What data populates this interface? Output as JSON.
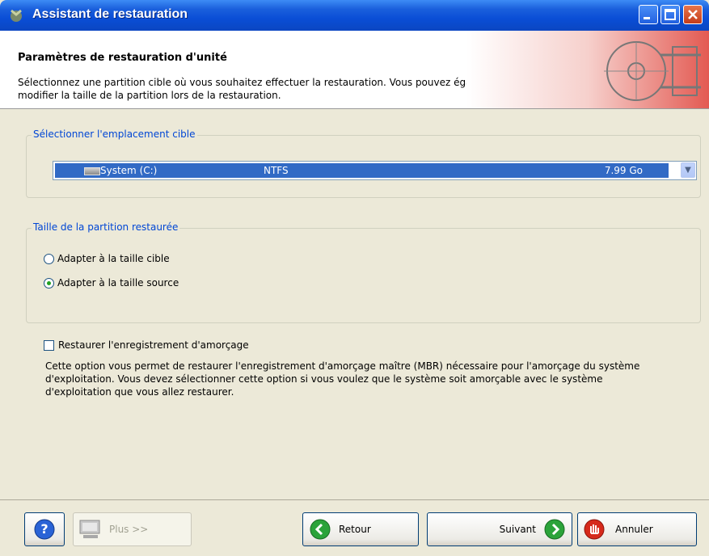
{
  "window": {
    "title": "Assistant de restauration"
  },
  "header": {
    "title": "Paramètres de restauration d'unité",
    "description": "Sélectionnez une partition cible où vous souhaitez effectuer la restauration. Vous pouvez également modifier la taille de la partition lors de la restauration."
  },
  "target": {
    "legend": "Sélectionner l'emplacement cible",
    "selected": {
      "name": "System (C:)",
      "filesystem": "NTFS",
      "size": "7.99 Go"
    }
  },
  "size_group": {
    "legend": "Taille de la partition restaurée",
    "options": [
      {
        "label": "Adapter à la taille cible",
        "checked": false
      },
      {
        "label": "Adapter à la taille source",
        "checked": true
      }
    ]
  },
  "mbr": {
    "label": "Restaurer l'enregistrement d'amorçage",
    "checked": false,
    "description": "Cette option vous permet de restaurer l'enregistrement d'amorçage maître (MBR) nécessaire pour l'amorçage du système d'exploitation. Vous devez sélectionner cette option si vous voulez que le système soit amorçable avec le système d'exploitation que vous allez restaurer."
  },
  "footer": {
    "more_label": "Plus >>",
    "back_label": "Retour",
    "next_label": "Suivant",
    "cancel_label": "Annuler"
  },
  "colors": {
    "accent": "#0046d5",
    "selection": "#316ac5",
    "titlebar": "#0a4ed6"
  }
}
